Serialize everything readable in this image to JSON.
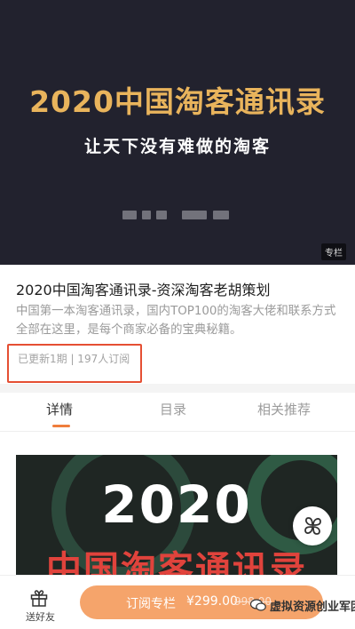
{
  "hero": {
    "title": "2020中国淘客通讯录",
    "subtitle": "让天下没有难做的淘客",
    "badge": "专栏"
  },
  "info": {
    "title": "2020中国淘客通讯录-资深淘客老胡策划",
    "description": "中国第一本淘客通讯录，国内TOP100的淘客大佬和联系方式全部在这里，是每个商家必备的宝典秘籍。",
    "meta": "已更新1期 | 197人订阅"
  },
  "tabs": [
    {
      "label": "详情",
      "active": true
    },
    {
      "label": "目录",
      "active": false
    },
    {
      "label": "相关推荐",
      "active": false
    }
  ],
  "content_image": {
    "year": "2020",
    "heading": "中国淘客通讯录"
  },
  "bottom_bar": {
    "gift_label": "送好友",
    "subscribe_label": "订阅专栏",
    "price": "¥299.00",
    "original_price": "998.00",
    "watermark": "虚拟资源创业军团"
  },
  "colors": {
    "hero_bg": "#22222e",
    "hero_title": "#e9b45c",
    "accent_orange": "#f5a46b",
    "highlight_red": "#e54f33"
  }
}
